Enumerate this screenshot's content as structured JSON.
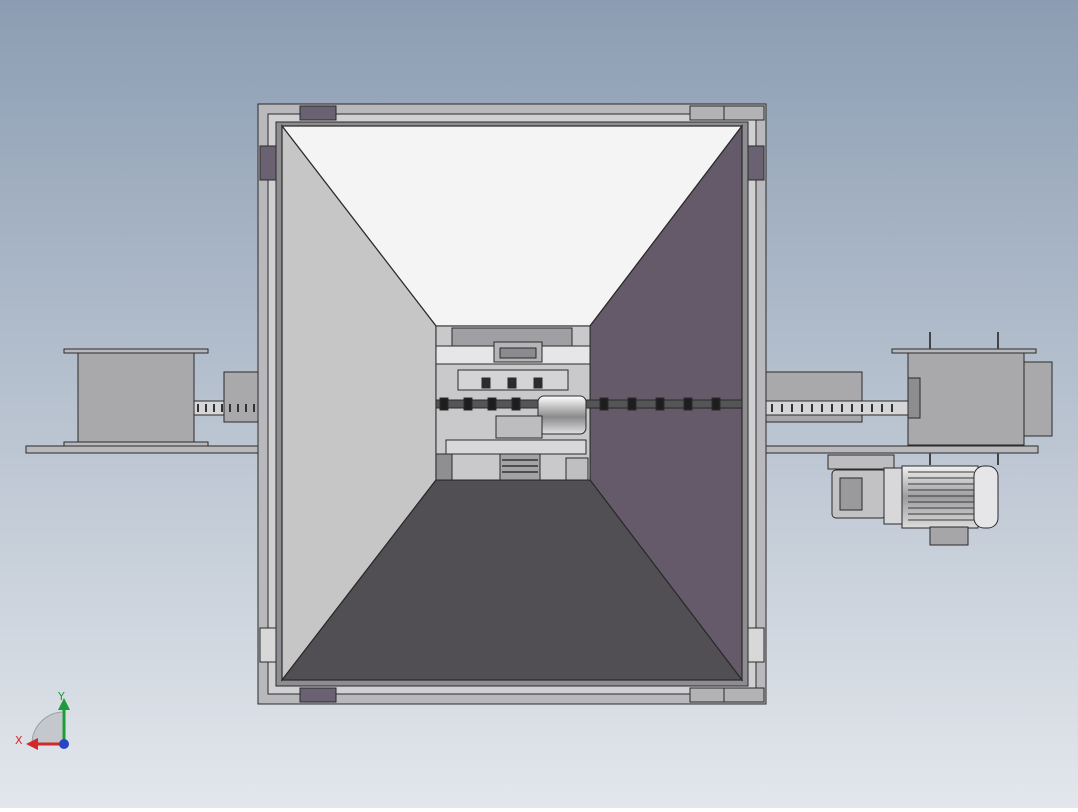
{
  "viewport": {
    "background_top": "#8c9db3",
    "background_bottom": "#e3e7ec"
  },
  "model": {
    "colors": {
      "frame": "#b9b9bd",
      "frame_dark": "#6e6e76",
      "panel_top": "#f4f4f4",
      "panel_left": "#c6c6c6",
      "panel_right": "#655a69",
      "panel_bottom": "#514f53",
      "housing": "#a9a9ab",
      "motor": "#cfcfd2",
      "corner_block": "#6a6172",
      "edge": "#2a2a2a"
    }
  },
  "triad": {
    "x_label": "X",
    "y_label": "Y",
    "x_color": "#d0282c",
    "y_color": "#1f9c3a",
    "z_color": "#2a44c8"
  }
}
